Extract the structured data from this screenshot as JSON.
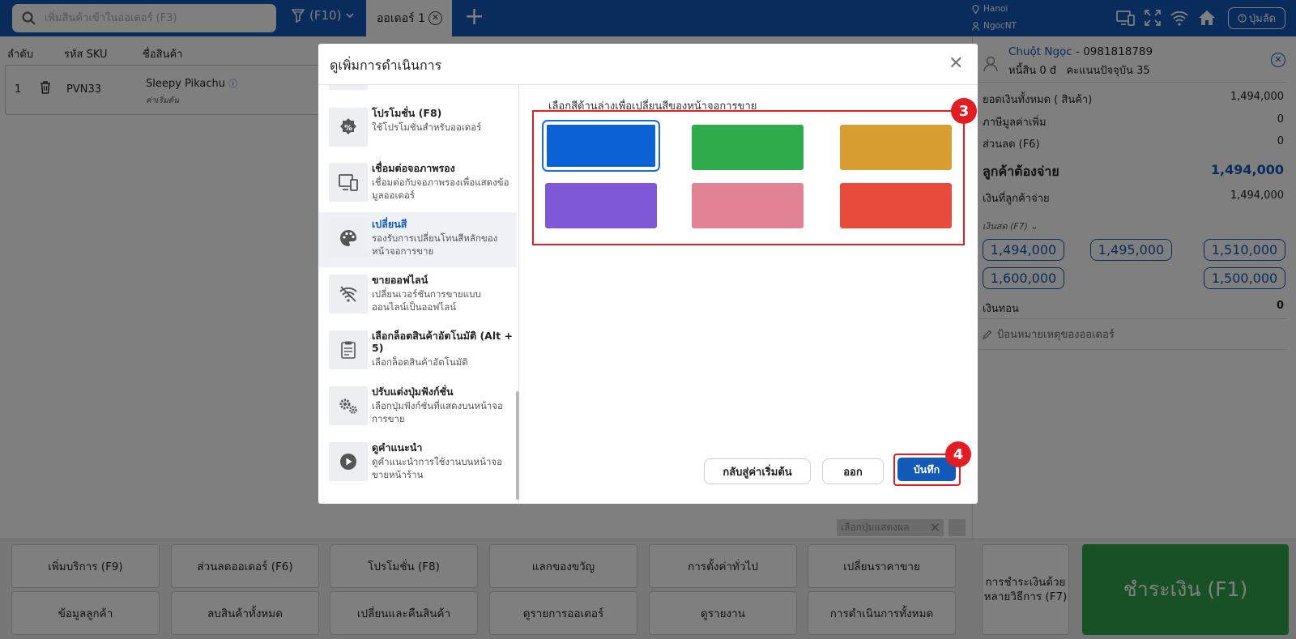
{
  "topbar": {
    "search_placeholder": "เพิ่มสินค้าเข้าในออเดอร์ (F3)",
    "f10_label": "(F10)",
    "tab_label": "ออเดอร์ 1",
    "location": "Hanoi",
    "user": "NgocNT",
    "help_label": "ปุ่มลัด"
  },
  "table": {
    "headers": [
      "ลำดับ",
      "รหัส SKU",
      "ชื่อสินค้า"
    ],
    "row": {
      "no": "1",
      "sku": "PVN33",
      "name": "Sleepy Pikachu",
      "sub": "ค่าเริ่มต้น"
    }
  },
  "customer": {
    "name": "Chuột Ngọc",
    "phone": " - 0981818789",
    "debt": "หนี้สิน 0 đ",
    "points": "คะแนนปัจจุบัน 35"
  },
  "summary": {
    "total_label": "ยอดเงินทั้งหมด ( สินค้า)",
    "total_value": "1,494,000",
    "vat_label": "ภาษีมูลค่าเพิ่ม",
    "vat_value": "0",
    "discount_label": "ส่วนลด (F6)",
    "discount_value": "0",
    "due_label": "ลูกค้าต้องจ่าย",
    "due_value": "1,494,000",
    "paid_label": "เงินที่ลูกค้าจ่าย",
    "paid_value": "1,494,000",
    "cash_label": "เงินสด (F7)",
    "change_label": "เงินทอน",
    "change_value": "0",
    "note_placeholder": "ป้อนหมายเหตุของออเดอร์"
  },
  "cash_suggestions": [
    "1,494,000",
    "1,495,000",
    "1,510,000",
    "1,600,000",
    "1,500,000"
  ],
  "bottom_buttons": [
    "เพิ่มบริการ (F9)",
    "ส่วนลดออเดอร์ (F6)",
    "โปรโมชั่น (F8)",
    "แลกของขวัญ",
    "การตั้งค่าทั่วไป",
    "เปลี่ยนราคาขาย",
    "ข้อมูลลูกค้า",
    "ลบสินค้าทั้งหมด",
    "เปลี่ยนและคืนสินค้า",
    "ดูรายการออเดอร์",
    "ดูรายงาน",
    "การดำเนินการทั้งหมด"
  ],
  "layout_tag": "เลือกปุ่มแสดงผล",
  "multi_pay_label": "การชำระเงินด้วยหลายวิธีการ (F7)",
  "pay_label": "ชำระเงิน (F1)",
  "modal": {
    "title": "ดูเพิ่มการดำเนินการ",
    "items": [
      {
        "title": "โปรโมชั่น (F8)",
        "desc": "ใช้โปรโมชั่นสำหรับออเดอร์",
        "icon": "promotion-icon"
      },
      {
        "title": "เชื่อมต่อจอภาพรอง",
        "desc": "เชื่อมต่อกับจอภาพรองเพื่อแสดงข้อมูลออเดอร์",
        "icon": "devices-icon"
      },
      {
        "title": "เปลี่ยนสี",
        "desc": "รองรับการเปลี่ยนโทนสีหลักของหน้าจอการขาย",
        "icon": "palette-icon"
      },
      {
        "title": "ขายออฟไลน์",
        "desc": "เปลี่ยนเวอร์ชันการขายแบบออนไลน์เป็นออฟไลน์",
        "icon": "wifi-off-icon"
      },
      {
        "title": "เลือกล็อตสินค้าอัตโนมัติ (Alt + 5)",
        "desc": "เลือกล็อตสินค้าอัตโนมัติ",
        "icon": "lot-icon"
      },
      {
        "title": "ปรับแต่งปุ่มฟังก์ชั่น",
        "desc": "เลือกปุ่มฟังก์ชั่นที่แสดงบนหน้าจอการขาย",
        "icon": "gears-icon"
      },
      {
        "title": "ดูคำแนะนำ",
        "desc": "ดูคำแนะนำการใช้งานบนหน้าจอขายหน้าร้าน",
        "icon": "play-icon"
      }
    ],
    "hint": "เลือกสีด้านล่างเพื่อเปลี่ยนสีของหน้าจอการขาย",
    "colors": [
      "#0d63d6",
      "#2fab4c",
      "#d79f31",
      "#7e58d6",
      "#e28395",
      "#e84b3b"
    ],
    "badge_colors": "3",
    "badge_save": "4",
    "reset_label": "กลับสู่ค่าเริ่มต้น",
    "exit_label": "ออก",
    "save_label": "บันทึก"
  }
}
